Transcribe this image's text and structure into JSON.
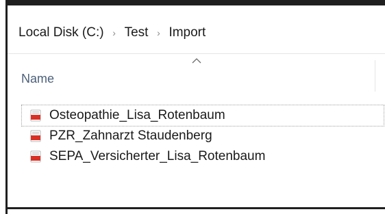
{
  "breadcrumb": {
    "items": [
      "Local Disk (C:)",
      "Test",
      "Import"
    ],
    "separator": "›"
  },
  "columns": {
    "name": "Name"
  },
  "files": [
    {
      "name": "Osteopathie_Lisa_Rotenbaum",
      "icon": "pdf-icon",
      "focused": true
    },
    {
      "name": "PZR_Zahnarzt Staudenberg",
      "icon": "pdf-icon",
      "focused": false
    },
    {
      "name": "SEPA_Versicherter_Lisa_Rotenbaum",
      "icon": "pdf-icon",
      "focused": false
    }
  ],
  "colors": {
    "frame": "#1f1f1f",
    "header_text": "#4c607a",
    "pdf_red": "#d93025"
  }
}
